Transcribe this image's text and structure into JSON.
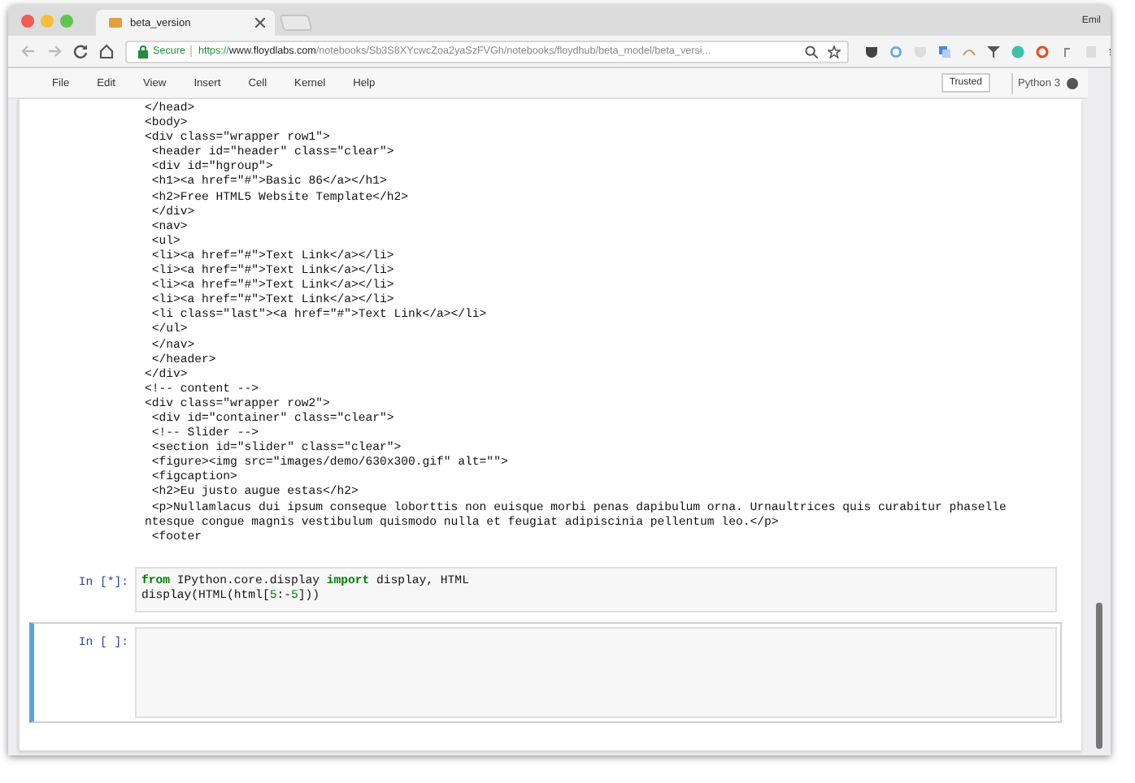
{
  "window": {
    "tab_title": "beta_version",
    "user": "Emil"
  },
  "address_bar": {
    "secure_label": "Secure",
    "url_scheme": "https://",
    "url_host": "www.floydlabs.com",
    "url_path": "/notebooks/Sb3S8XYcwcZoa2yaSzFVGh/notebooks/floydhub/beta_model/beta_versi..."
  },
  "menu": [
    "File",
    "Edit",
    "View",
    "Insert",
    "Cell",
    "Kernel",
    "Help"
  ],
  "trusted": "Trusted",
  "kernel": {
    "name": "Python 3",
    "busy": true
  },
  "output_lines": [
    "</head>",
    "<body>",
    "<div class=\"wrapper row1\">",
    " <header id=\"header\" class=\"clear\">",
    " <div id=\"hgroup\">",
    " <h1><a href=\"#\">Basic 86</a></h1>",
    " <h2>Free HTML5 Website Template</h2>",
    " </div>",
    " <nav>",
    " <ul>",
    " <li><a href=\"#\">Text Link</a></li>",
    " <li><a href=\"#\">Text Link</a></li>",
    " <li><a href=\"#\">Text Link</a></li>",
    " <li><a href=\"#\">Text Link</a></li>",
    " <li class=\"last\"><a href=\"#\">Text Link</a></li>",
    " </ul>",
    " </nav>",
    " </header>",
    "</div>",
    "<!-- content -->",
    "<div class=\"wrapper row2\">",
    " <div id=\"container\" class=\"clear\">",
    " <!-- Slider -->",
    " <section id=\"slider\" class=\"clear\">",
    " <figure><img src=\"images/demo/630x300.gif\" alt=\"\">",
    " <figcaption>",
    " <h2>Eu justo augue estas</h2>",
    " <p>Nullamlacus dui ipsum conseque loborttis non euisque morbi penas dapibulum orna. Urnaultrices quis curabitur phaselle",
    "ntesque congue magnis vestibulum quismodo nulla et feugiat adipiscinia pellentum leo.</p>",
    " <footer"
  ],
  "cells": [
    {
      "prompt": "In [*]:",
      "selected": false,
      "lines": [
        [
          {
            "kind": "keyword",
            "text": "from"
          },
          {
            "kind": "plain",
            "text": " IPython.core.display "
          },
          {
            "kind": "keyword",
            "text": "import"
          },
          {
            "kind": "plain",
            "text": " display, HTML"
          }
        ],
        [
          {
            "kind": "plain",
            "text": "display(HTML(html["
          },
          {
            "kind": "number",
            "text": "5"
          },
          {
            "kind": "plain",
            "text": ":-"
          },
          {
            "kind": "number",
            "text": "5"
          },
          {
            "kind": "plain",
            "text": "]))"
          }
        ]
      ]
    },
    {
      "prompt": "In [ ]:",
      "selected": true
    }
  ]
}
